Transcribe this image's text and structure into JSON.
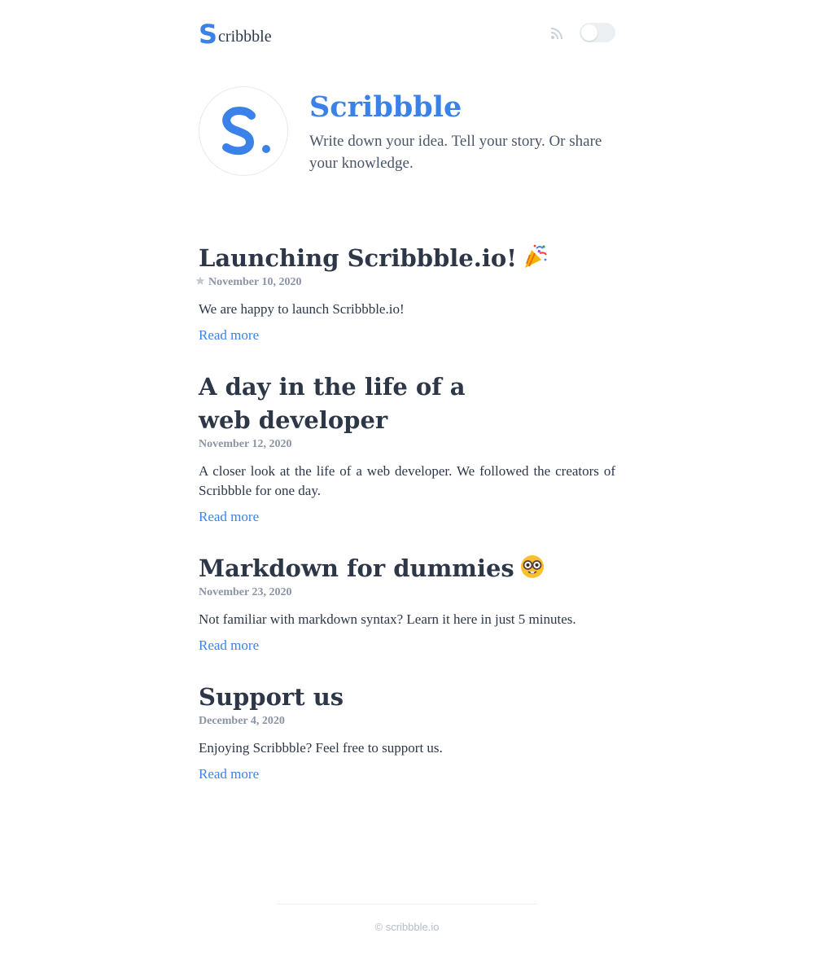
{
  "header": {
    "logo_letter": "S",
    "logo_text": "cribbble",
    "rss_icon": "rss-icon",
    "theme_toggle_state": "off"
  },
  "hero": {
    "title": "Scribbble",
    "tagline": "Write down your idea. Tell your story. Or share your knowledge.",
    "avatar_icon": "scribbble-logo-s"
  },
  "posts": [
    {
      "title": "Launching Scribbble.io!",
      "emoji": "party-popper-icon",
      "pinned": true,
      "date": "November 10, 2020",
      "summary": "We are happy to launch Scribbble.io!",
      "link_label": "Read more"
    },
    {
      "title": "A day in the life of a web developer",
      "emoji": "",
      "pinned": false,
      "date": "November 12, 2020",
      "summary": "A closer look at the life of a web developer. We followed the creators of Scribbble for one day.",
      "link_label": "Read more"
    },
    {
      "title": "Markdown for dummies",
      "emoji": "nerd-face-icon",
      "pinned": false,
      "date": "November 23, 2020",
      "summary": "Not familiar with markdown syntax? Learn it here in just 5 minutes.",
      "link_label": "Read more"
    },
    {
      "title": "Support us",
      "emoji": "",
      "pinned": false,
      "date": "December 4, 2020",
      "summary": "Enjoying Scribbble? Feel free to support us.",
      "link_label": "Read more"
    }
  ],
  "footer": {
    "text": "© scribbble.io"
  },
  "colors": {
    "accent": "#3b82e8",
    "heading": "#2d3748",
    "muted": "#8a94a3"
  }
}
